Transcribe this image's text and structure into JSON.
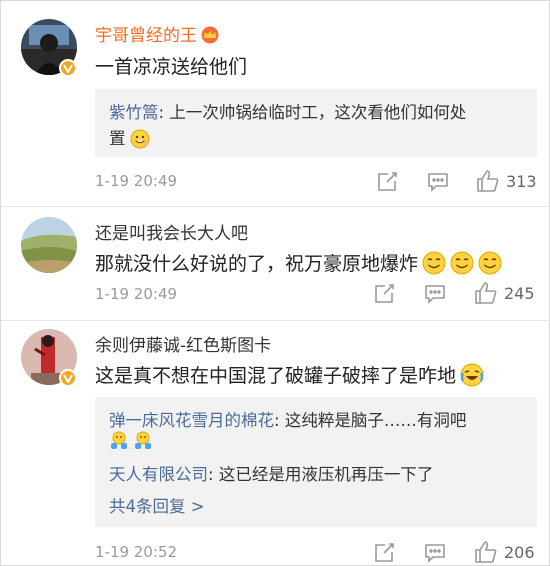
{
  "comments": [
    {
      "username": "宇哥曾经的王",
      "text": "一首凉凉送给他们",
      "replies": [
        {
          "name": "紫竹篙",
          "sep": ": ",
          "line1": "上一次帅锅给临时工，这次看他们如何处",
          "line2": "置"
        }
      ],
      "time": "1-19 20:49",
      "likes": "313"
    },
    {
      "username": "还是叫我会长大人吧",
      "text": "那就没什么好说的了，祝万豪原地爆炸",
      "time": "1-19 20:49",
      "likes": "245"
    },
    {
      "username": "余则伊藤诚-红色斯图卡",
      "text": "这是真不想在中国混了破罐子破摔了是咋地",
      "replies": [
        {
          "name": "弹一床风花雪月的棉花",
          "sep": ": ",
          "line1": "这纯粹是脑子……有洞吧"
        },
        {
          "name": "天人有限公司",
          "sep": ": ",
          "line1": "这已经是用液压机再压一下了"
        }
      ],
      "more": "共4条回复 >",
      "time": "1-19 20:52",
      "likes": "206"
    }
  ],
  "icons": {
    "verified": "verified-badge-icon",
    "vip": "vip-crown-icon",
    "repost": "repost-icon",
    "comment": "comment-icon",
    "like": "like-icon"
  },
  "colors": {
    "vip_name": "#f86b1f",
    "reply_name": "#4c6b99",
    "meta": "#9a9a9a",
    "badge": "#f5a623"
  }
}
